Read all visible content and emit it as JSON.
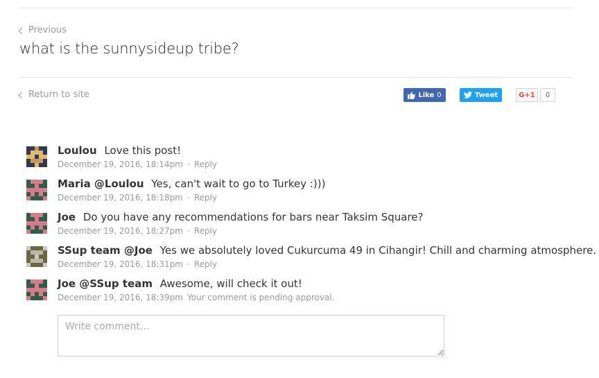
{
  "nav": {
    "previous_label": "Previous",
    "return_label": "Return to site"
  },
  "post": {
    "title": "what is the sunnysideup tribe?"
  },
  "share": {
    "facebook": {
      "label": "Like",
      "count": "0"
    },
    "twitter": {
      "label": "Tweet"
    },
    "googleplus": {
      "label": "G+1",
      "count": "0"
    },
    "colors": {
      "facebook": "#4267b2",
      "twitter": "#1da1f2",
      "googleplus": "#dd4b39"
    }
  },
  "comments": [
    {
      "author": "Loulou",
      "text": "Love this post!",
      "date": "December 19, 2016, 18:14pm",
      "action": "Reply",
      "avatar": "pixel-avatar-gold"
    },
    {
      "author": "Maria @Loulou",
      "text": "Yes, can't wait to go to Turkey :)))",
      "date": "December 19, 2016, 18:18pm",
      "action": "Reply",
      "avatar": "pixel-avatar-pink"
    },
    {
      "author": "Joe",
      "text": "Do you have any recommendations for bars near Taksim Square?",
      "date": "December 19, 2016, 18:27pm",
      "action": "Reply",
      "avatar": "pixel-avatar-pink"
    },
    {
      "author": "SSup team @Joe",
      "text": "Yes we absolutely loved Cukurcuma 49 in Cihangir! Chill and charming atmosphere.",
      "date": "December 19, 2016, 18:31pm",
      "action": "Reply",
      "avatar": "pixel-avatar-gray"
    },
    {
      "author": "Joe @SSup team",
      "text": "Awesome, will check it out!",
      "date": "December 19, 2016, 18:39pm",
      "status": "Your comment is pending approval.",
      "avatar": "pixel-avatar-pink"
    }
  ],
  "comment_form": {
    "placeholder": "Write comment..."
  }
}
